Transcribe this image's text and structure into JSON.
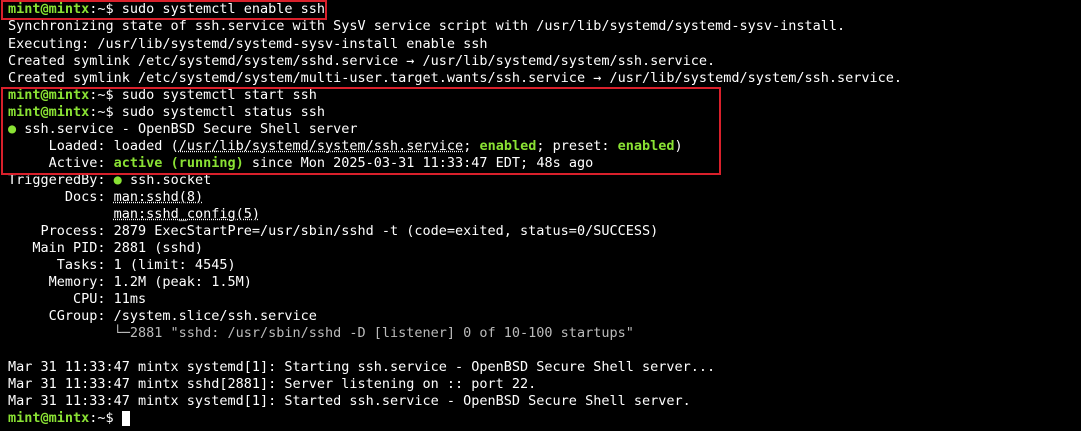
{
  "prompt": {
    "user": "mint@mintx",
    "sep": ":~$ "
  },
  "commands": {
    "enable": "sudo systemctl enable ssh",
    "start": "sudo systemctl start ssh",
    "status": "sudo systemctl status ssh"
  },
  "enable_output": [
    "Synchronizing state of ssh.service with SysV service script with /usr/lib/systemd/systemd-sysv-install.",
    "Executing: /usr/lib/systemd/systemd-sysv-install enable ssh",
    "Created symlink /etc/systemd/system/sshd.service → /usr/lib/systemd/system/ssh.service.",
    "Created symlink /etc/systemd/system/multi-user.target.wants/ssh.service → /usr/lib/systemd/system/ssh.service."
  ],
  "status": {
    "dot": "●",
    "title": " ssh.service - OpenBSD Secure Shell server",
    "loaded_label": "     Loaded: ",
    "loaded_pre": "loaded (",
    "loaded_path": "/usr/lib/systemd/system/ssh.service",
    "loaded_mid": "; ",
    "enabled": "enabled",
    "loaded_mid2": "; preset: ",
    "preset": "enabled",
    "loaded_post": ")",
    "active_label": "     Active: ",
    "active_state": "active (running)",
    "active_rest": " since Mon 2025-03-31 11:33:47 EDT; 48s ago",
    "triggered_label": "TriggeredBy: ",
    "triggered_dot": "●",
    "triggered_value": " ssh.socket",
    "docs_label": "       Docs: ",
    "docs1": "man:sshd(8)",
    "docs_indent": "             ",
    "docs2": "man:sshd_config(5)",
    "process": "    Process: 2879 ExecStartPre=/usr/sbin/sshd -t (code=exited, status=0/SUCCESS)",
    "mainpid": "   Main PID: 2881 (sshd)",
    "tasks": "      Tasks: 1 (limit: 4545)",
    "memory": "     Memory: 1.2M (peak: 1.5M)",
    "cpu": "        CPU: 11ms",
    "cgroup": "     CGroup: /system.slice/ssh.service",
    "cgroup_child": "             └─2881 \"sshd: /usr/sbin/sshd -D [listener] 0 of 10-100 startups\""
  },
  "log": [
    "Mar 31 11:33:47 mintx systemd[1]: Starting ssh.service - OpenBSD Secure Shell server...",
    "Mar 31 11:33:47 mintx sshd[2881]: Server listening on :: port 22.",
    "Mar 31 11:33:47 mintx systemd[1]: Started ssh.service - OpenBSD Secure Shell server."
  ],
  "colors": {
    "background": "#000000",
    "prompt": "#8ae234",
    "highlight_box": "#d9202b"
  }
}
